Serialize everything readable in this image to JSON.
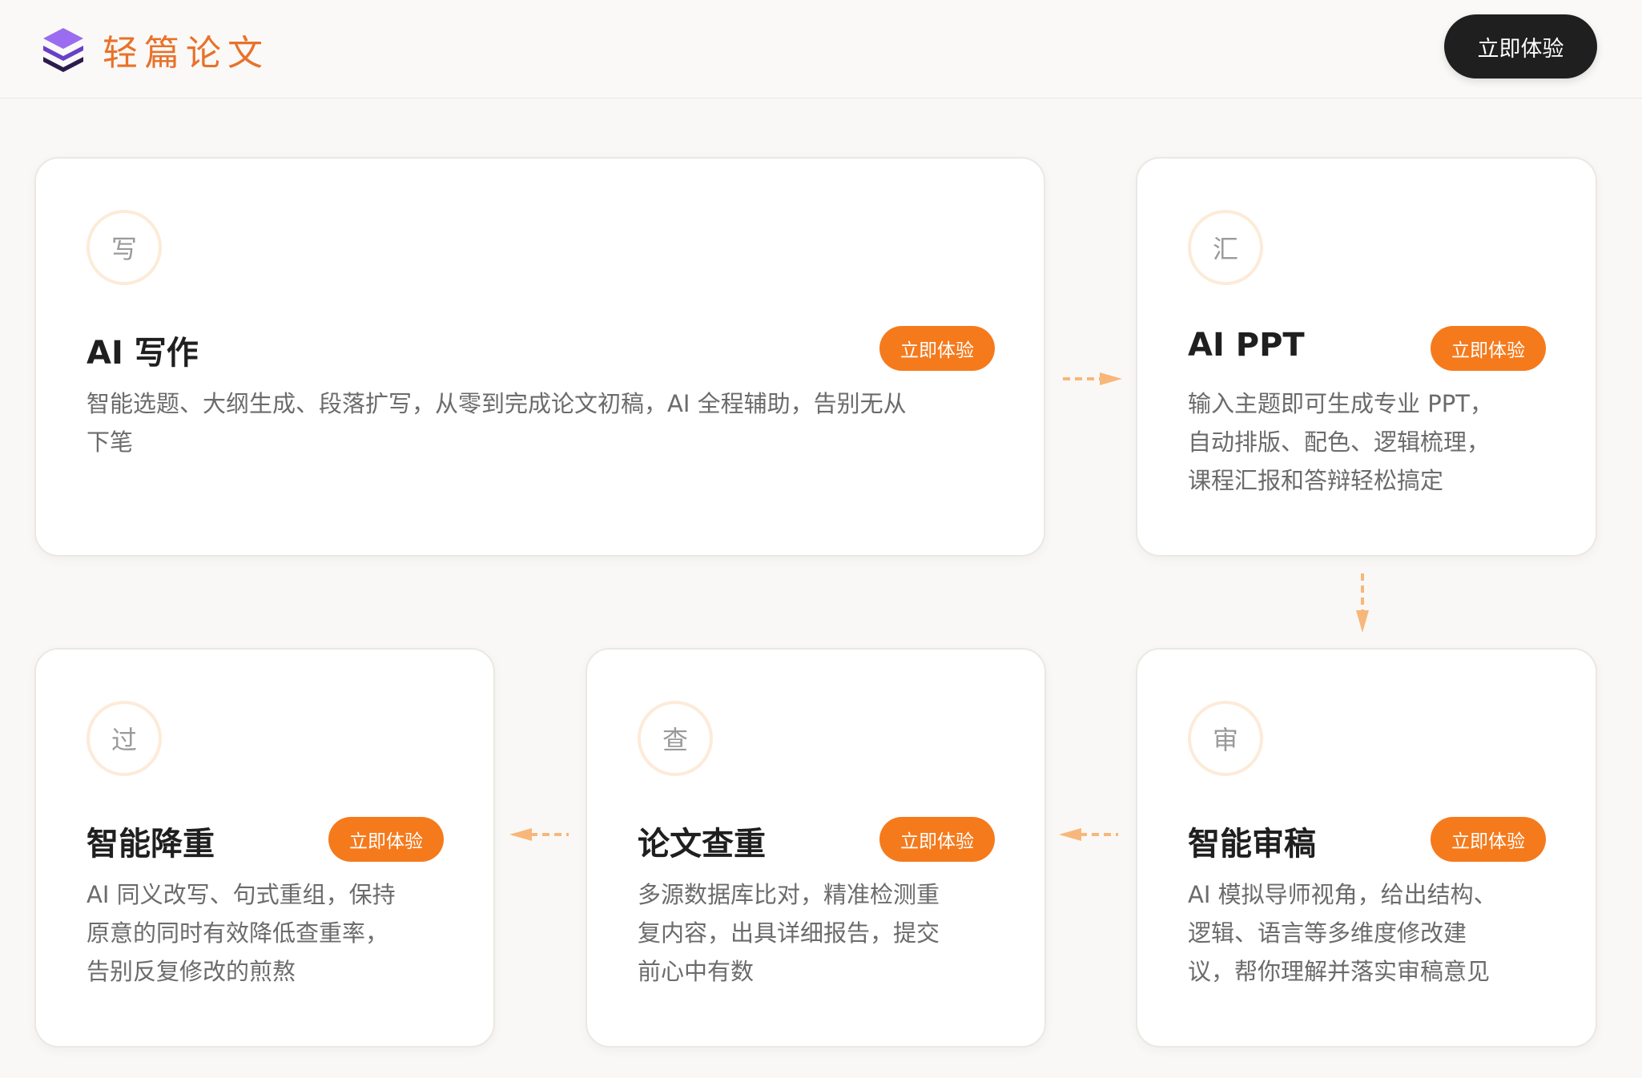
{
  "header": {
    "brand": "轻篇论文",
    "cta_label": "立即体验"
  },
  "colors": {
    "accent": "#f57a1c",
    "brand_text": "#e8722a",
    "logo_purple": "#7c4ddb",
    "dark_button": "#1f1f1f",
    "arrow": "#f8b77a"
  },
  "cards": [
    {
      "icon_char": "写",
      "title": "AI 写作",
      "cta": "立即体验",
      "desc": [
        "智能选题、大纲生成、段落扩写，从零到完成论文初稿，AI 全程辅助，告别无从",
        "下笔"
      ]
    },
    {
      "icon_char": "汇",
      "title": "AI PPT",
      "cta": "立即体验",
      "desc": [
        "输入主题即可生成专业 PPT，",
        "自动排版、配色、逻辑梳理，",
        "课程汇报和答辩轻松搞定"
      ]
    },
    {
      "icon_char": "审",
      "title": "智能审稿",
      "cta": "立即体验",
      "desc": [
        "AI 模拟导师视角，给出结构、",
        "逻辑、语言等多维度修改建",
        "议，帮你理解并落实审稿意见"
      ]
    },
    {
      "icon_char": "查",
      "title": "论文查重",
      "cta": "立即体验",
      "desc": [
        "多源数据库比对，精准检测重",
        "复内容，出具详细报告，提交",
        "前心中有数"
      ]
    },
    {
      "icon_char": "过",
      "title": "智能降重",
      "cta": "立即体验",
      "desc": [
        "AI 同义改写、句式重组，保持",
        "原意的同时有效降低查重率，",
        "告别反复修改的煎熬"
      ]
    }
  ]
}
